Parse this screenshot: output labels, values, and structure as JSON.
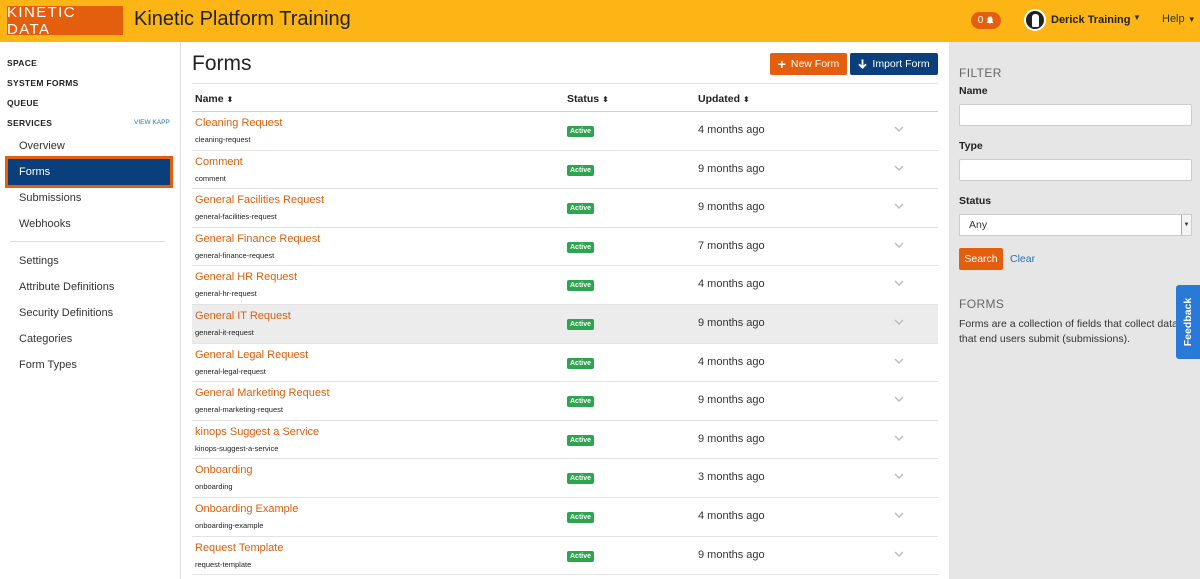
{
  "header": {
    "logo_text": "KINETIC DATA",
    "app_title": "Kinetic Platform Training",
    "notification_count": "0",
    "user_name": "Derick Training",
    "help_label": "Help"
  },
  "sidebar": {
    "space_label": "SPACE",
    "system_forms_label": "SYSTEM FORMS",
    "queue_label": "QUEUE",
    "services_label": "SERVICES",
    "view_kapp_label": "VIEW KAPP",
    "kapp_items": [
      {
        "label": "Overview"
      },
      {
        "label": "Forms",
        "active": true
      },
      {
        "label": "Submissions"
      },
      {
        "label": "Webhooks"
      }
    ],
    "settings_items": [
      {
        "label": "Settings"
      },
      {
        "label": "Attribute Definitions"
      },
      {
        "label": "Security Definitions"
      },
      {
        "label": "Categories"
      },
      {
        "label": "Form Types"
      }
    ]
  },
  "main": {
    "title": "Forms",
    "new_form_label": "New Form",
    "import_form_label": "Import Form",
    "columns": {
      "name": "Name",
      "status": "Status",
      "updated": "Updated"
    },
    "rows": [
      {
        "name": "Cleaning Request",
        "slug": "cleaning-request",
        "status": "Active",
        "updated": "4 months ago"
      },
      {
        "name": "Comment",
        "slug": "comment",
        "status": "Active",
        "updated": "9 months ago"
      },
      {
        "name": "General Facilities Request",
        "slug": "general-facilities-request",
        "status": "Active",
        "updated": "9 months ago"
      },
      {
        "name": "General Finance Request",
        "slug": "general-finance-request",
        "status": "Active",
        "updated": "7 months ago"
      },
      {
        "name": "General HR Request",
        "slug": "general-hr-request",
        "status": "Active",
        "updated": "4 months ago"
      },
      {
        "name": "General IT Request",
        "slug": "general-it-request",
        "status": "Active",
        "updated": "9 months ago",
        "highlighted": true
      },
      {
        "name": "General Legal Request",
        "slug": "general-legal-request",
        "status": "Active",
        "updated": "4 months ago"
      },
      {
        "name": "General Marketing Request",
        "slug": "general-marketing-request",
        "status": "Active",
        "updated": "9 months ago"
      },
      {
        "name": "kinops Suggest a Service",
        "slug": "kinops-suggest-a-service",
        "status": "Active",
        "updated": "9 months ago"
      },
      {
        "name": "Onboarding",
        "slug": "onboarding",
        "status": "Active",
        "updated": "3 months ago"
      },
      {
        "name": "Onboarding Example",
        "slug": "onboarding-example",
        "status": "Active",
        "updated": "4 months ago"
      },
      {
        "name": "Request Template",
        "slug": "request-template",
        "status": "Active",
        "updated": "9 months ago"
      }
    ]
  },
  "filter": {
    "title": "FILTER",
    "name_label": "Name",
    "name_value": "",
    "type_label": "Type",
    "type_value": "",
    "status_label": "Status",
    "status_value": "Any",
    "search_label": "Search",
    "clear_label": "Clear",
    "forms_heading": "FORMS",
    "forms_description_line1": "Forms are a collection of fields that collect data",
    "forms_description_line2": "that end users submit (submissions)."
  },
  "feedback_label": "Feedback",
  "colors": {
    "header_bg": "#fdb515",
    "brand_orange": "#e35f0e",
    "nav_active_bg": "#0a3f7c",
    "status_active": "#2da44e",
    "feedback_blue": "#2979d8"
  }
}
